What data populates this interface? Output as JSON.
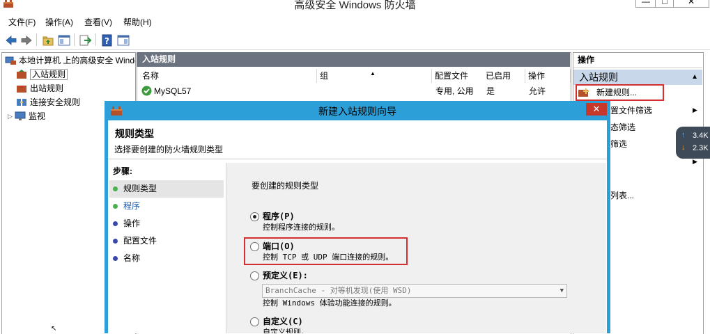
{
  "window": {
    "title": "高级安全 Windows 防火墙",
    "min": "—",
    "max": "□",
    "close": "✕"
  },
  "menubar": [
    "文件(F)",
    "操作(A)",
    "查看(V)",
    "帮助(H)"
  ],
  "tree": {
    "root": "本地计算机 上的高级安全 Windows",
    "items": [
      "入站规则",
      "出站规则",
      "连接安全规则",
      "监视"
    ]
  },
  "center": {
    "header": "入站规则",
    "columns": [
      "名称",
      "组",
      "配置文件",
      "已启用",
      "操作"
    ],
    "rows": [
      {
        "name": "MySQL57",
        "group": "",
        "profile": "专用, 公用",
        "enabled": "是",
        "action": "允许"
      }
    ]
  },
  "actions": {
    "header": "操作",
    "section": "入站规则",
    "items": [
      "新建规则...",
      "按配置文件筛选",
      "按状态筛选",
      "按组筛选",
      "",
      "列表..."
    ],
    "visible_fragments": [
      "置文件筛选",
      "态筛选",
      "筛选",
      "列表..."
    ]
  },
  "network": {
    "up": "3.4K",
    "down": "2.3K"
  },
  "dialog": {
    "title": "新建入站规则向导",
    "close": "✕",
    "heading": "规则类型",
    "subheading": "选择要创建的防火墙规则类型",
    "steps_label": "步骤:",
    "steps": [
      {
        "label": "规则类型",
        "color": "#4caf50",
        "current": true
      },
      {
        "label": "程序",
        "color": "#4caf50",
        "current": false
      },
      {
        "label": "操作",
        "color": "#3949ab",
        "current": false
      },
      {
        "label": "配置文件",
        "color": "#3949ab",
        "current": false
      },
      {
        "label": "名称",
        "color": "#3949ab",
        "current": false
      }
    ],
    "prompt": "要创建的规则类型",
    "options": [
      {
        "label": "程序(P)",
        "desc": "控制程序连接的规则。",
        "selected": true
      },
      {
        "label": "端口(O)",
        "desc": "控制 TCP 或 UDP 端口连接的规则。",
        "selected": false
      },
      {
        "label": "预定义(E):",
        "desc": "控制 Windows 体验功能连接的规则。",
        "selected": false
      },
      {
        "label": "自定义(C)",
        "desc": "自定义规则。",
        "selected": false
      }
    ],
    "predefined_value": "BranchCache - 对等机发现(使用 WSD)"
  },
  "colors": {
    "accent": "#2d9fd8",
    "highlight": "#d32f2f",
    "section": "#c9d7ea"
  }
}
